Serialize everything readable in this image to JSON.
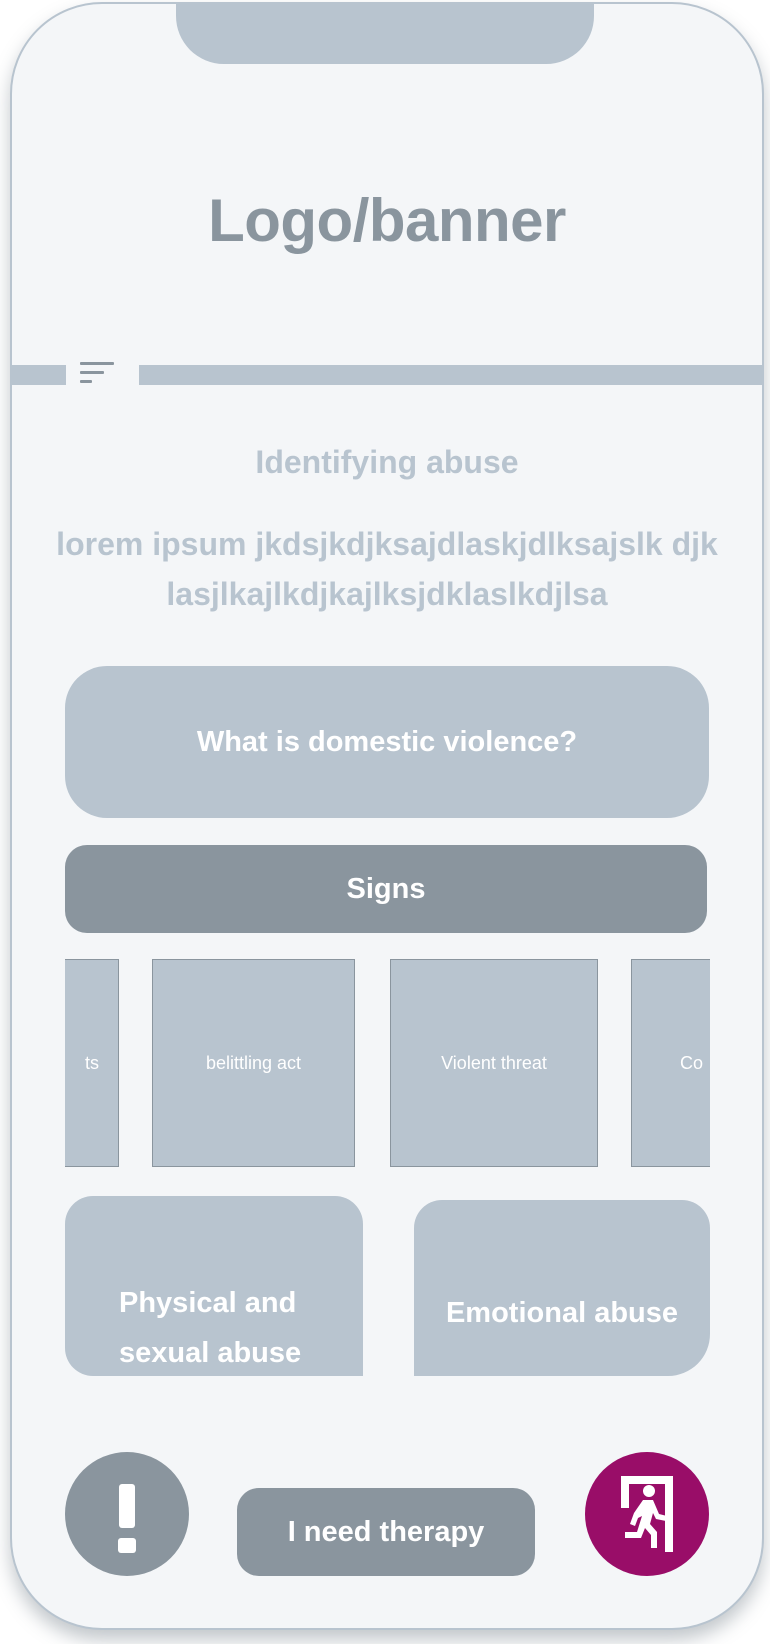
{
  "header": {
    "logo_text": "Logo/banner"
  },
  "main": {
    "section_title": "Identifying abuse",
    "intro_text": "lorem ipsum jkdsjkdjksajdlaskjdlksajslk djklasjlkajlkdjkajlksjdklaslkdjlsa",
    "what_card_label": "What is domestic violence?",
    "signs_button_label": "Signs",
    "sign_cards": [
      {
        "label": "ts"
      },
      {
        "label": "belittling act"
      },
      {
        "label": "Violent threat"
      },
      {
        "label": "Co"
      }
    ],
    "categories": [
      {
        "label": "Physical and sexual abuse"
      },
      {
        "label": "Emotional abuse"
      }
    ]
  },
  "footer": {
    "alert_icon": "exclamation-icon",
    "therapy_button_label": "I need therapy",
    "exit_icon": "emergency-exit-icon"
  },
  "colors": {
    "background": "#f4f6f8",
    "light_gray": "#b8c4cf",
    "dark_gray": "#8a959e",
    "exit_accent": "#990d68",
    "text_on_card": "#ffffff"
  }
}
